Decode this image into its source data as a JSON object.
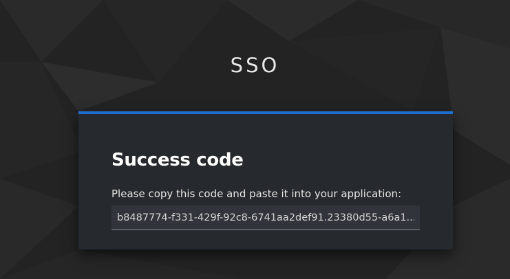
{
  "header": {
    "app_title": "SSO"
  },
  "card": {
    "title": "Success code",
    "instruction": "Please copy this code and paste it into your application:",
    "code_value": "b8487774-f331-429f-92c8-6741aa2def91.23380d55-a6a1..."
  },
  "colors": {
    "background": "#232323",
    "card_background": "#26292d",
    "accent": "#1f6fd1",
    "field_background": "#31343a"
  }
}
